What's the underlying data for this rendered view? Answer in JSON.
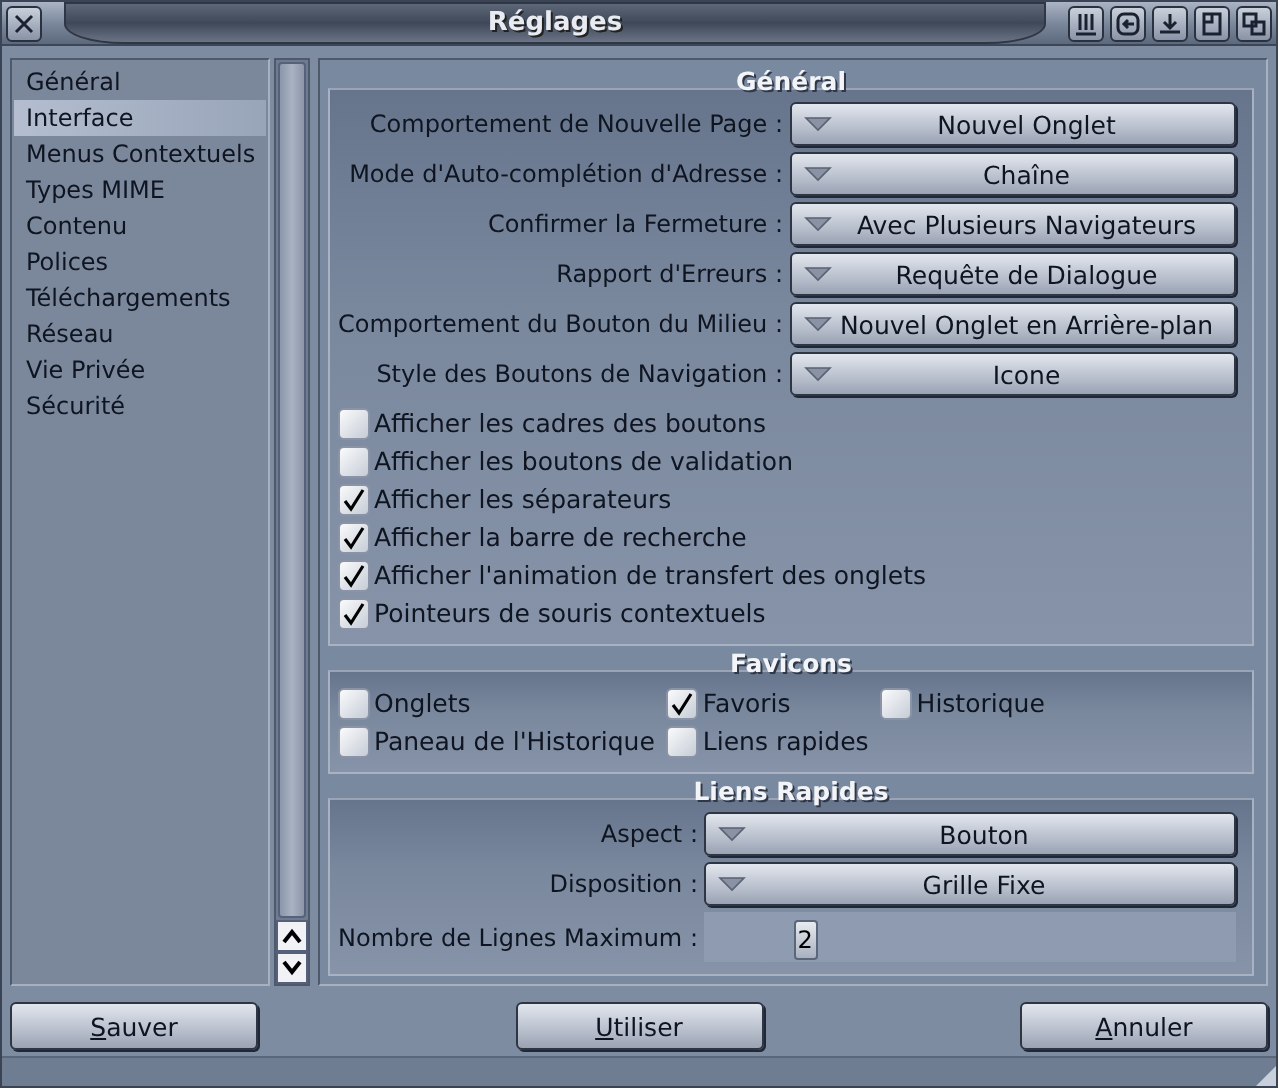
{
  "window": {
    "title": "Réglages"
  },
  "sidebar": {
    "items": [
      {
        "label": "Général",
        "selected": false
      },
      {
        "label": "Interface",
        "selected": true
      },
      {
        "label": "Menus Contextuels",
        "selected": false
      },
      {
        "label": "Types MIME",
        "selected": false
      },
      {
        "label": "Contenu",
        "selected": false
      },
      {
        "label": "Polices",
        "selected": false
      },
      {
        "label": "Téléchargements",
        "selected": false
      },
      {
        "label": "Réseau",
        "selected": false
      },
      {
        "label": "Vie Privée",
        "selected": false
      },
      {
        "label": "Sécurité",
        "selected": false
      }
    ]
  },
  "general": {
    "title": "Général",
    "cycles": [
      {
        "label": "Comportement de Nouvelle Page :",
        "value": "Nouvel Onglet"
      },
      {
        "label": "Mode d'Auto-complétion d'Adresse :",
        "value": "Chaîne"
      },
      {
        "label": "Confirmer la Fermeture :",
        "value": "Avec Plusieurs Navigateurs"
      },
      {
        "label": "Rapport d'Erreurs :",
        "value": "Requête de Dialogue"
      },
      {
        "label": "Comportement du Bouton du Milieu :",
        "value": "Nouvel Onglet en Arrière-plan"
      },
      {
        "label": "Style des Boutons de Navigation :",
        "value": "Icone"
      }
    ],
    "checkboxes": [
      {
        "label": "Afficher les cadres des boutons",
        "checked": false
      },
      {
        "label": "Afficher les boutons de validation",
        "checked": false
      },
      {
        "label": "Afficher les séparateurs",
        "checked": true
      },
      {
        "label": "Afficher la barre de recherche",
        "checked": true
      },
      {
        "label": "Afficher l'animation de transfert des onglets",
        "checked": true
      },
      {
        "label": "Pointeurs de souris contextuels",
        "checked": true
      }
    ]
  },
  "favicons": {
    "title": "Favicons",
    "checkboxes": [
      {
        "label": "Onglets",
        "checked": false
      },
      {
        "label": "Favoris",
        "checked": true
      },
      {
        "label": "Historique",
        "checked": false
      },
      {
        "label": "Paneau de l'Historique",
        "checked": false
      },
      {
        "label": "Liens rapides",
        "checked": false
      }
    ]
  },
  "quick_links": {
    "title": "Liens Rapides",
    "cycles": [
      {
        "label": "Aspect :",
        "value": "Bouton"
      },
      {
        "label": "Disposition :",
        "value": "Grille Fixe"
      }
    ],
    "slider": {
      "label": "Nombre de Lignes Maximum :",
      "value": "2",
      "level": 0.19
    }
  },
  "buttons": [
    {
      "label": "Sauver",
      "underline_first": true
    },
    {
      "label": "Utiliser",
      "underline_first": true
    },
    {
      "label": "Annuler",
      "underline_first": true
    }
  ]
}
